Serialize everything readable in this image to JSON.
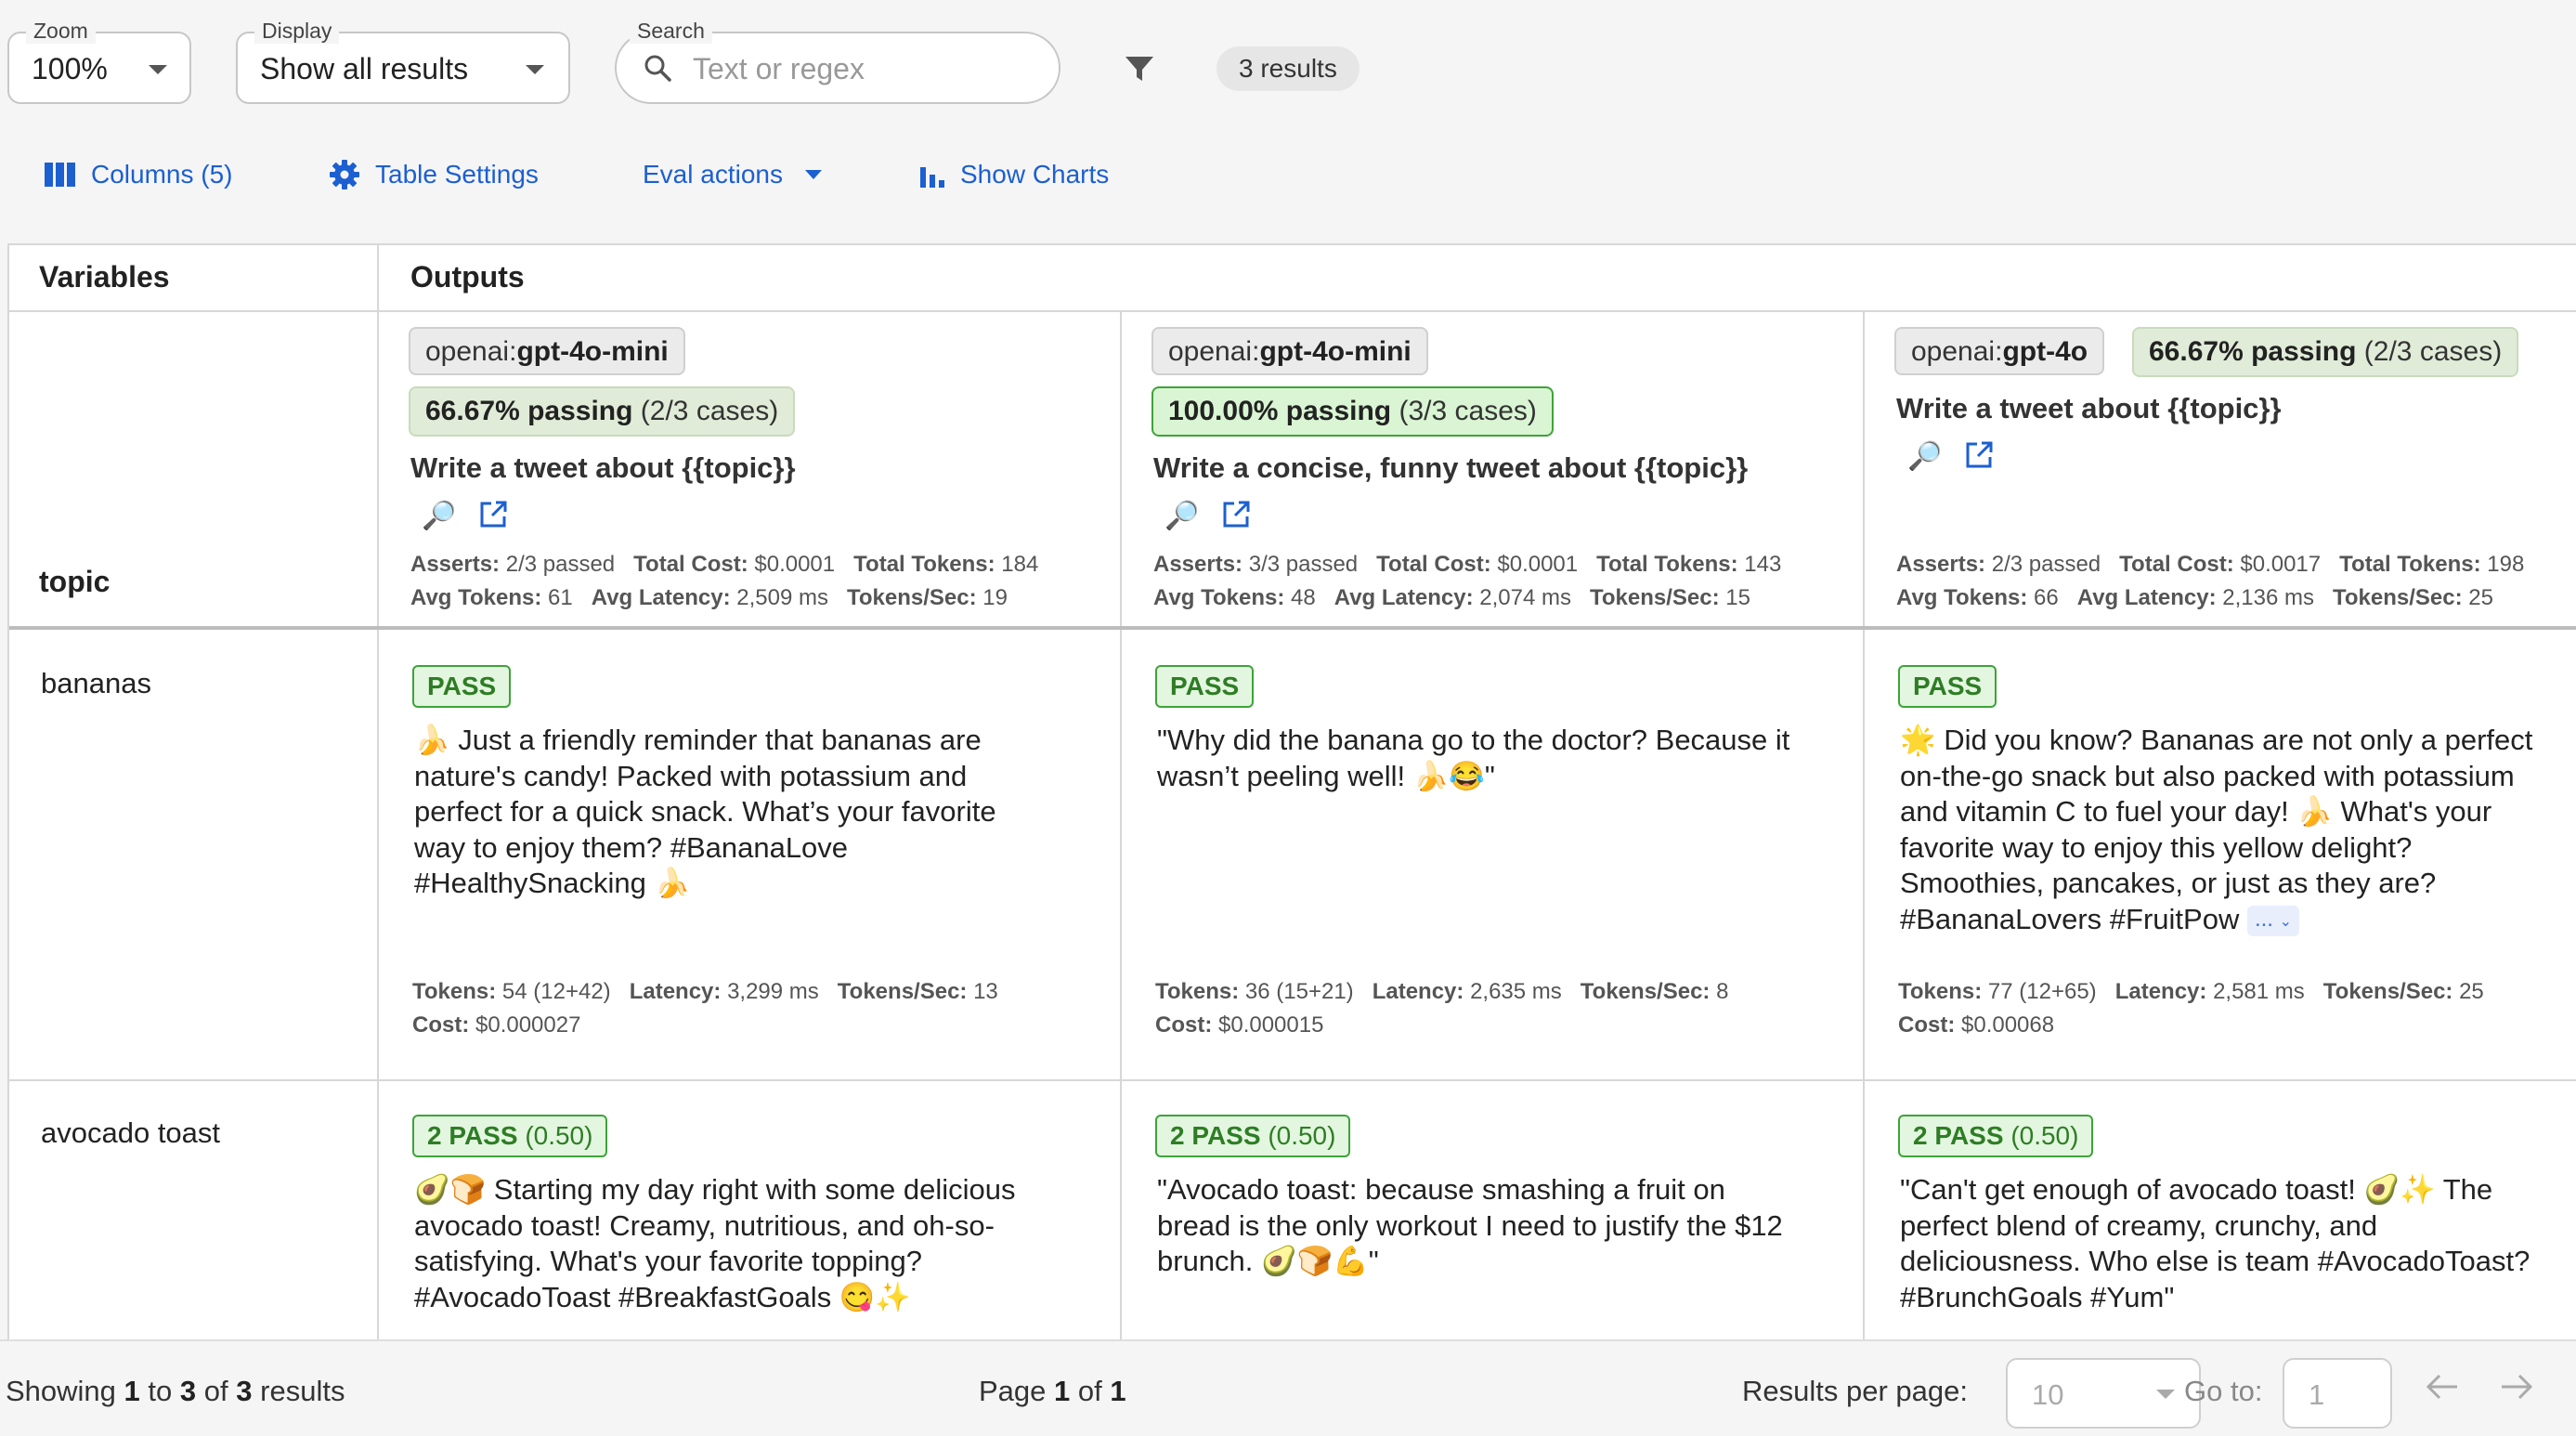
{
  "controls": {
    "zoom": {
      "label": "Zoom",
      "value": "100%"
    },
    "display": {
      "label": "Display",
      "value": "Show all results"
    },
    "search": {
      "label": "Search",
      "placeholder": "Text or regex"
    },
    "results_count": "3 results"
  },
  "toolbar": {
    "columns": "Columns (5)",
    "table_settings": "Table Settings",
    "eval_actions": "Eval actions",
    "show_charts": "Show Charts"
  },
  "table": {
    "variables_header": "Variables",
    "outputs_header": "Outputs",
    "variable_name": "topic",
    "columns": [
      {
        "provider_prefix": "openai:",
        "provider_model": "gpt-4o-mini",
        "pass_rate": "66.67% passing",
        "pass_cases": "(2/3 cases)",
        "pass_full": false,
        "prompt": "Write a tweet about {{topic}}",
        "asserts": "2/3 passed",
        "total_cost": "$0.0001",
        "total_tokens": "184",
        "avg_tokens": "61",
        "avg_latency": "2,509 ms",
        "tokens_sec": "19"
      },
      {
        "provider_prefix": "openai:",
        "provider_model": "gpt-4o-mini",
        "pass_rate": "100.00% passing",
        "pass_cases": "(3/3 cases)",
        "pass_full": true,
        "prompt": "Write a concise, funny tweet about {{topic}}",
        "asserts": "3/3 passed",
        "total_cost": "$0.0001",
        "total_tokens": "143",
        "avg_tokens": "48",
        "avg_latency": "2,074 ms",
        "tokens_sec": "15"
      },
      {
        "provider_prefix": "openai:",
        "provider_model": "gpt-4o",
        "pass_rate": "66.67% passing",
        "pass_cases": "(2/3 cases)",
        "pass_full": false,
        "prompt": "Write a tweet about {{topic}}",
        "asserts": "2/3 passed",
        "total_cost": "$0.0017",
        "total_tokens": "198",
        "avg_tokens": "66",
        "avg_latency": "2,136 ms",
        "tokens_sec": "25"
      }
    ],
    "rows": [
      {
        "variable": "bananas",
        "cells": [
          {
            "status": "PASS",
            "score": "",
            "text": "🍌 Just a friendly reminder that bananas are\nnature's candy! Packed with potassium and\nperfect for a quick snack. What’s your favorite\nway to enjoy them? #BananaLove\n#HealthySnacking 🍌",
            "tokens": "54 (12+42)",
            "latency": "3,299 ms",
            "tokens_sec": "13",
            "cost": "$0.000027"
          },
          {
            "status": "PASS",
            "score": "",
            "text": "\"Why did the banana go to the doctor? Because it\nwasn’t peeling well! 🍌😂\"",
            "tokens": "36 (15+21)",
            "latency": "2,635 ms",
            "tokens_sec": "8",
            "cost": "$0.000015"
          },
          {
            "status": "PASS",
            "score": "",
            "text": "🌟 Did you know? Bananas are not only a perfect\non-the-go snack but also packed with potassium\nand vitamin C to fuel your day! 🍌 What's your\nfavorite way to enjoy this yellow delight?\nSmoothies, pancakes, or just as they are?\n#BananaLovers #FruitPow",
            "ellipsis": "...",
            "tokens": "77 (12+65)",
            "latency": "2,581 ms",
            "tokens_sec": "25",
            "cost": "$0.00068"
          }
        ]
      },
      {
        "variable": "avocado toast",
        "cells": [
          {
            "status": "2 PASS",
            "score": "(0.50)",
            "text": "🥑🍞 Starting my day right with some delicious\navocado toast! Creamy, nutritious, and oh-so-\nsatisfying. What's your favorite topping?\n#AvocadoToast #BreakfastGoals 😋✨"
          },
          {
            "status": "2 PASS",
            "score": "(0.50)",
            "text": "\"Avocado toast: because smashing a fruit on\nbread is the only workout I need to justify the $12\nbrunch. 🥑🍞💪\""
          },
          {
            "status": "2 PASS",
            "score": "(0.50)",
            "text": "\"Can't get enough of avocado toast! 🥑✨ The\nperfect blend of creamy, crunchy, and\ndeliciousness. Who else is team #AvocadoToast?\n#BrunchGoals #Yum\""
          }
        ]
      }
    ],
    "labels": {
      "asserts": "Asserts:",
      "total_cost": "Total Cost:",
      "total_tokens": "Total Tokens:",
      "avg_tokens": "Avg Tokens:",
      "avg_latency": "Avg Latency:",
      "tokens_sec": "Tokens/Sec:",
      "tokens": "Tokens:",
      "latency": "Latency:",
      "cost": "Cost:"
    }
  },
  "footer": {
    "showing_prefix": "Showing",
    "showing_from": "1",
    "showing_to_word": "to",
    "showing_to": "3",
    "showing_of_word": "of",
    "showing_total": "3",
    "showing_suffix": "results",
    "page_prefix": "Page",
    "page_current": "1",
    "page_of_word": "of",
    "page_total": "1",
    "per_page_label": "Results per page:",
    "per_page_value": "10",
    "goto_label": "Go to:",
    "goto_value": "1"
  }
}
